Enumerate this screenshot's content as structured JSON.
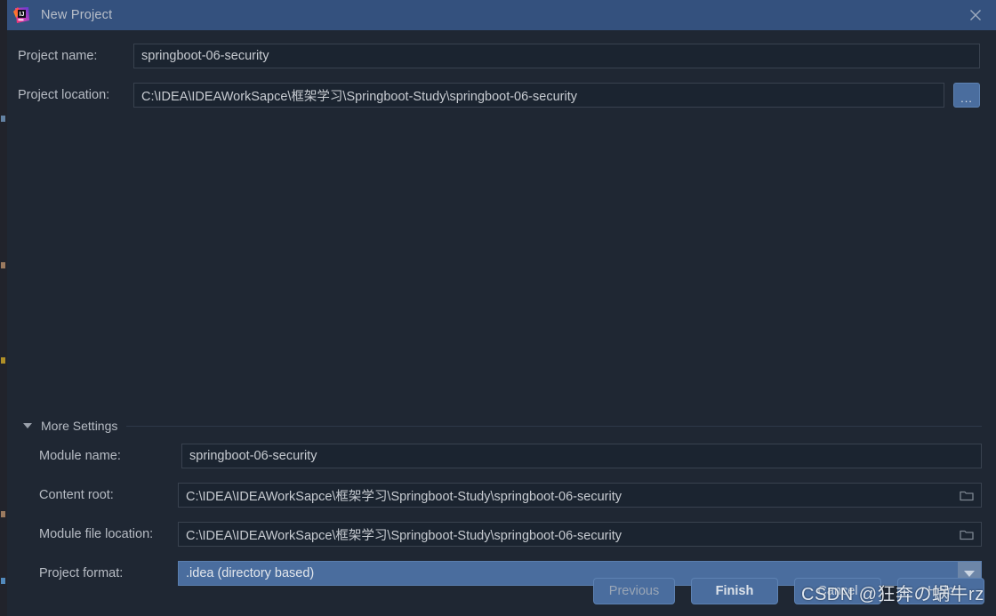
{
  "window": {
    "title": "New Project",
    "logo_icon": "intellij-idea-logo",
    "close_icon": "close-icon"
  },
  "form": {
    "project_name": {
      "label": "Project name:",
      "value": "springboot-06-security"
    },
    "project_location": {
      "label": "Project location:",
      "value": "C:\\IDEA\\IDEAWorkSapce\\框架学习\\Springboot-Study\\springboot-06-security",
      "browse_label": "..."
    }
  },
  "more_settings": {
    "label": "More Settings",
    "expanded": true,
    "toggle_icon": "triangle-down-icon",
    "module_name": {
      "label": "Module name:",
      "value": "springboot-06-security"
    },
    "content_root": {
      "label": "Content root:",
      "value": "C:\\IDEA\\IDEAWorkSapce\\框架学习\\Springboot-Study\\springboot-06-security",
      "browse_icon": "folder-icon"
    },
    "module_file_location": {
      "label": "Module file location:",
      "value": "C:\\IDEA\\IDEAWorkSapce\\框架学习\\Springboot-Study\\springboot-06-security",
      "browse_icon": "folder-icon"
    },
    "project_format": {
      "label": "Project format:",
      "value": ".idea (directory based)",
      "dropdown_icon": "chevron-down-icon"
    }
  },
  "footer": {
    "previous_label": "Previous",
    "finish_label": "Finish",
    "cancel_label": "Cancel",
    "help_label": "Help"
  },
  "watermark": {
    "text": "CSDN @狂奔の蜗牛rz"
  },
  "colors": {
    "titlebar": "#34517e",
    "dialog_bg": "#1f2733",
    "field_bg": "#1b2430",
    "accent": "#4a6d9e",
    "text": "#b7bcc4"
  }
}
